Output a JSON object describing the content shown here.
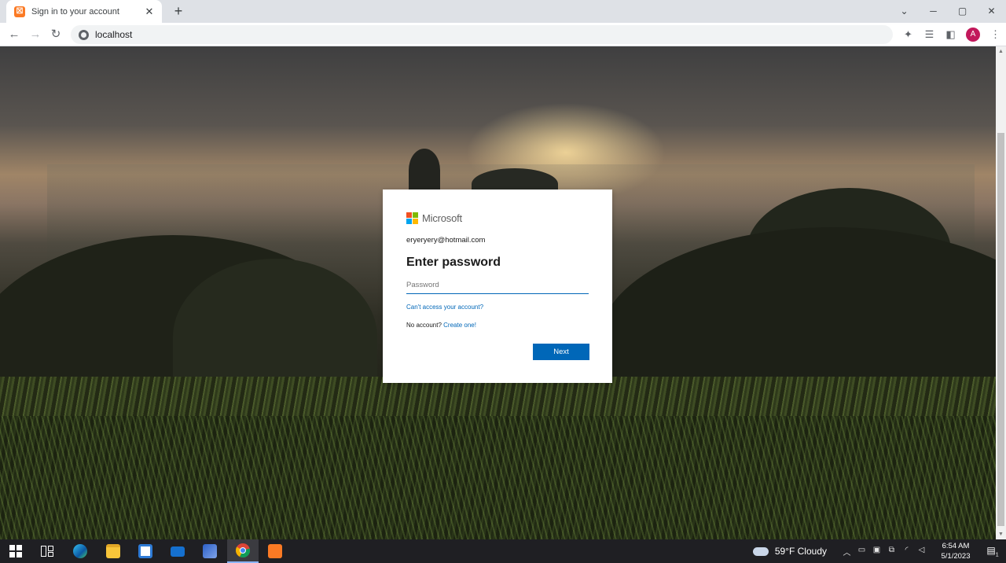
{
  "browser": {
    "tab_title": "Sign in to your account",
    "tab_favicon": "xampp-icon",
    "new_tab": "+",
    "url": "localhost",
    "profile_initial": "A"
  },
  "signin": {
    "brand": "Microsoft",
    "identity": "eryeryery@hotmail.com",
    "heading": "Enter password",
    "password_placeholder": "Password",
    "cant_access": "Can't access your account?",
    "no_account": "No account?",
    "create_one": "Create one!",
    "next_label": "Next",
    "brand_colors": [
      "#f25022",
      "#7fba00",
      "#00a4ef",
      "#ffb900"
    ],
    "accent": "#0067b8"
  },
  "taskbar": {
    "weather": "59°F  Cloudy",
    "time": "6:54 AM",
    "date": "5/1/2023",
    "notification_count": "1",
    "apps": [
      "windows-start-icon",
      "task-view-icon",
      "edge-icon",
      "file-explorer-icon",
      "store-icon",
      "mail-icon",
      "security-icon",
      "chrome-icon",
      "xampp-icon"
    ]
  }
}
